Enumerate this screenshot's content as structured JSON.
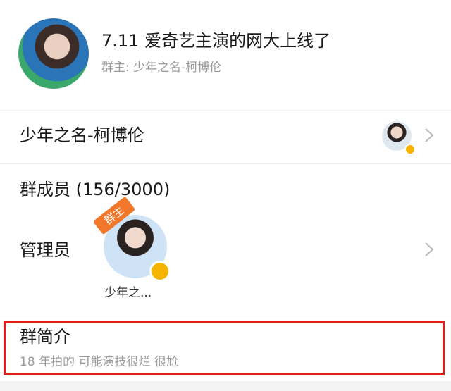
{
  "header": {
    "group_title": "7.11 爱奇艺主演的网大上线了",
    "owner_line": "群主: 少年之名-柯博伦"
  },
  "rows": {
    "group_name": "少年之名-柯博伦",
    "members": "群成员 (156/3000)",
    "admins_label": "管理员",
    "admin_name": "少年之...",
    "admin_tag": "群主",
    "intro_title": "群简介",
    "intro_text": "18 年拍的 可能演技很烂 很尬"
  },
  "colors": {
    "highlight_border": "#e01c1c",
    "owner_tag": "#f1772a",
    "verified_badge": "#f5b400",
    "secondary_text": "#9a9a9a"
  },
  "icons": {
    "chevron": "chevron-right-icon",
    "verified": "verified-badge-icon"
  }
}
